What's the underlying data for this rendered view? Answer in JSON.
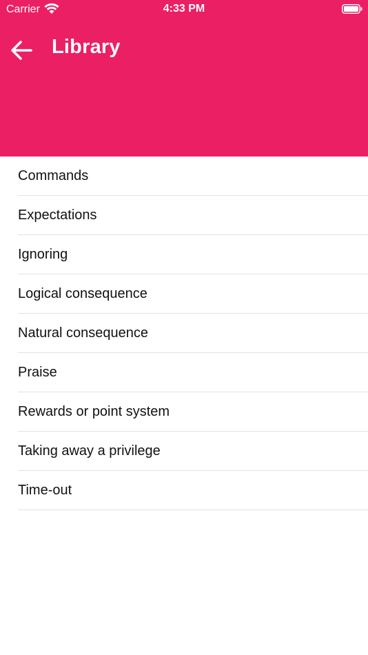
{
  "status_bar": {
    "carrier": "Carrier",
    "time": "4:33 PM"
  },
  "nav": {
    "title": "Library",
    "back_icon": "arrow-left-icon"
  },
  "colors": {
    "header_bg": "#EB1F63",
    "header_text": "#FFFFFF",
    "list_text": "#111111",
    "separator": "#E2E2E2"
  },
  "library_items": [
    {
      "label": "Commands"
    },
    {
      "label": "Expectations"
    },
    {
      "label": "Ignoring"
    },
    {
      "label": "Logical consequence"
    },
    {
      "label": "Natural consequence"
    },
    {
      "label": "Praise"
    },
    {
      "label": "Rewards or point system"
    },
    {
      "label": "Taking away a privilege"
    },
    {
      "label": "Time-out"
    }
  ]
}
